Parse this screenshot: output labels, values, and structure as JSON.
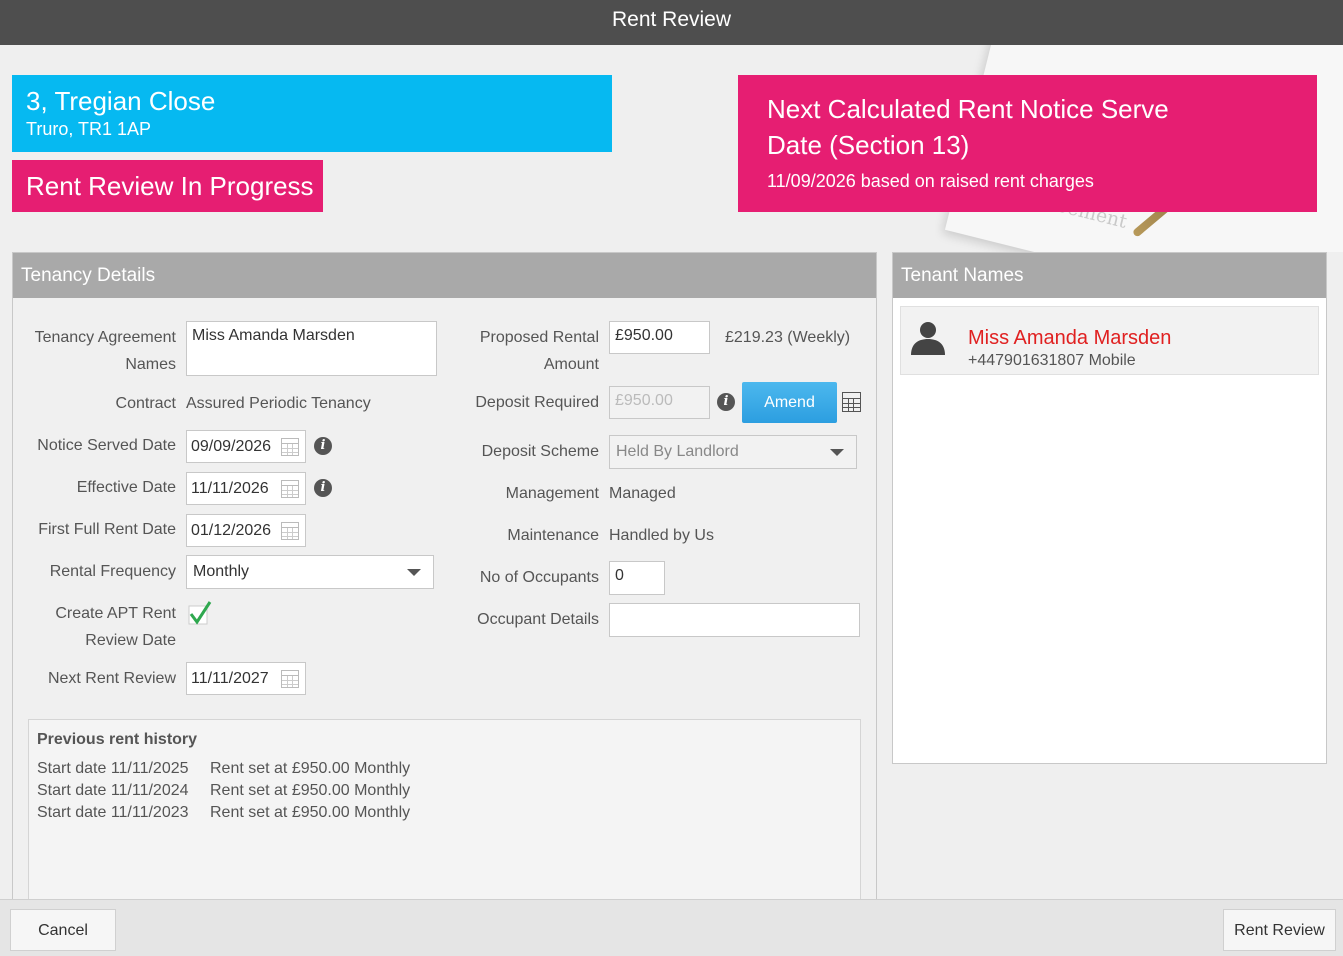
{
  "window": {
    "title": "Rent Review"
  },
  "property": {
    "address_line1": "3, Tregian Close",
    "address_line2": "Truro, TR1 1AP"
  },
  "status": {
    "label": "Rent Review In Progress"
  },
  "notice": {
    "title": "Next Calculated Rent Notice Serve Date (Section 13)",
    "subtitle": "11/09/2026 based on raised rent charges"
  },
  "background_watermark": "greement",
  "tenancy": {
    "header": "Tenancy Details",
    "agreement_names_label": "Tenancy Agreement Names",
    "agreement_names_value": "Miss Amanda Marsden",
    "contract_label": "Contract",
    "contract_value": "Assured Periodic Tenancy",
    "notice_served_label": "Notice Served Date",
    "notice_served_value": "09/09/2026",
    "effective_date_label": "Effective Date",
    "effective_date_value": "11/11/2026",
    "first_full_rent_label": "First Full Rent Date",
    "first_full_rent_value": "01/12/2026",
    "rental_frequency_label": "Rental Frequency",
    "rental_frequency_value": "Monthly",
    "create_apt_label": "Create APT Rent Review Date",
    "create_apt_checked": true,
    "next_rent_review_label": "Next Rent Review",
    "next_rent_review_value": "11/11/2027",
    "proposed_rental_label": "Proposed Rental Amount",
    "proposed_rental_value": "£950.00",
    "weekly_value": "£219.23 (Weekly)",
    "deposit_required_label": "Deposit Required",
    "deposit_required_value": "£950.00",
    "amend_label": "Amend",
    "deposit_scheme_label": "Deposit Scheme",
    "deposit_scheme_value": "Held By Landlord",
    "management_label": "Management",
    "management_value": "Managed",
    "maintenance_label": "Maintenance",
    "maintenance_value": "Handled by Us",
    "occupants_label": "No of Occupants",
    "occupants_value": "0",
    "occupant_details_label": "Occupant Details",
    "occupant_details_value": ""
  },
  "history": {
    "title": "Previous rent history",
    "rows": [
      {
        "start": "Start date 11/11/2025",
        "text": "Rent set at £950.00 Monthly"
      },
      {
        "start": "Start date 11/11/2024",
        "text": "Rent set at £950.00 Monthly"
      },
      {
        "start": "Start date 11/11/2023",
        "text": "Rent set at £950.00 Monthly"
      }
    ]
  },
  "tenants": {
    "header": "Tenant Names",
    "items": [
      {
        "name": "Miss Amanda Marsden",
        "phone": "+447901631807 Mobile"
      }
    ]
  },
  "footer": {
    "cancel_label": "Cancel",
    "submit_label": "Rent Review"
  },
  "colors": {
    "accent_blue": "#06b9f1",
    "accent_pink": "#e61e72",
    "tenant_name_red": "#e02020",
    "amend_blue": "#2c9ee0"
  }
}
